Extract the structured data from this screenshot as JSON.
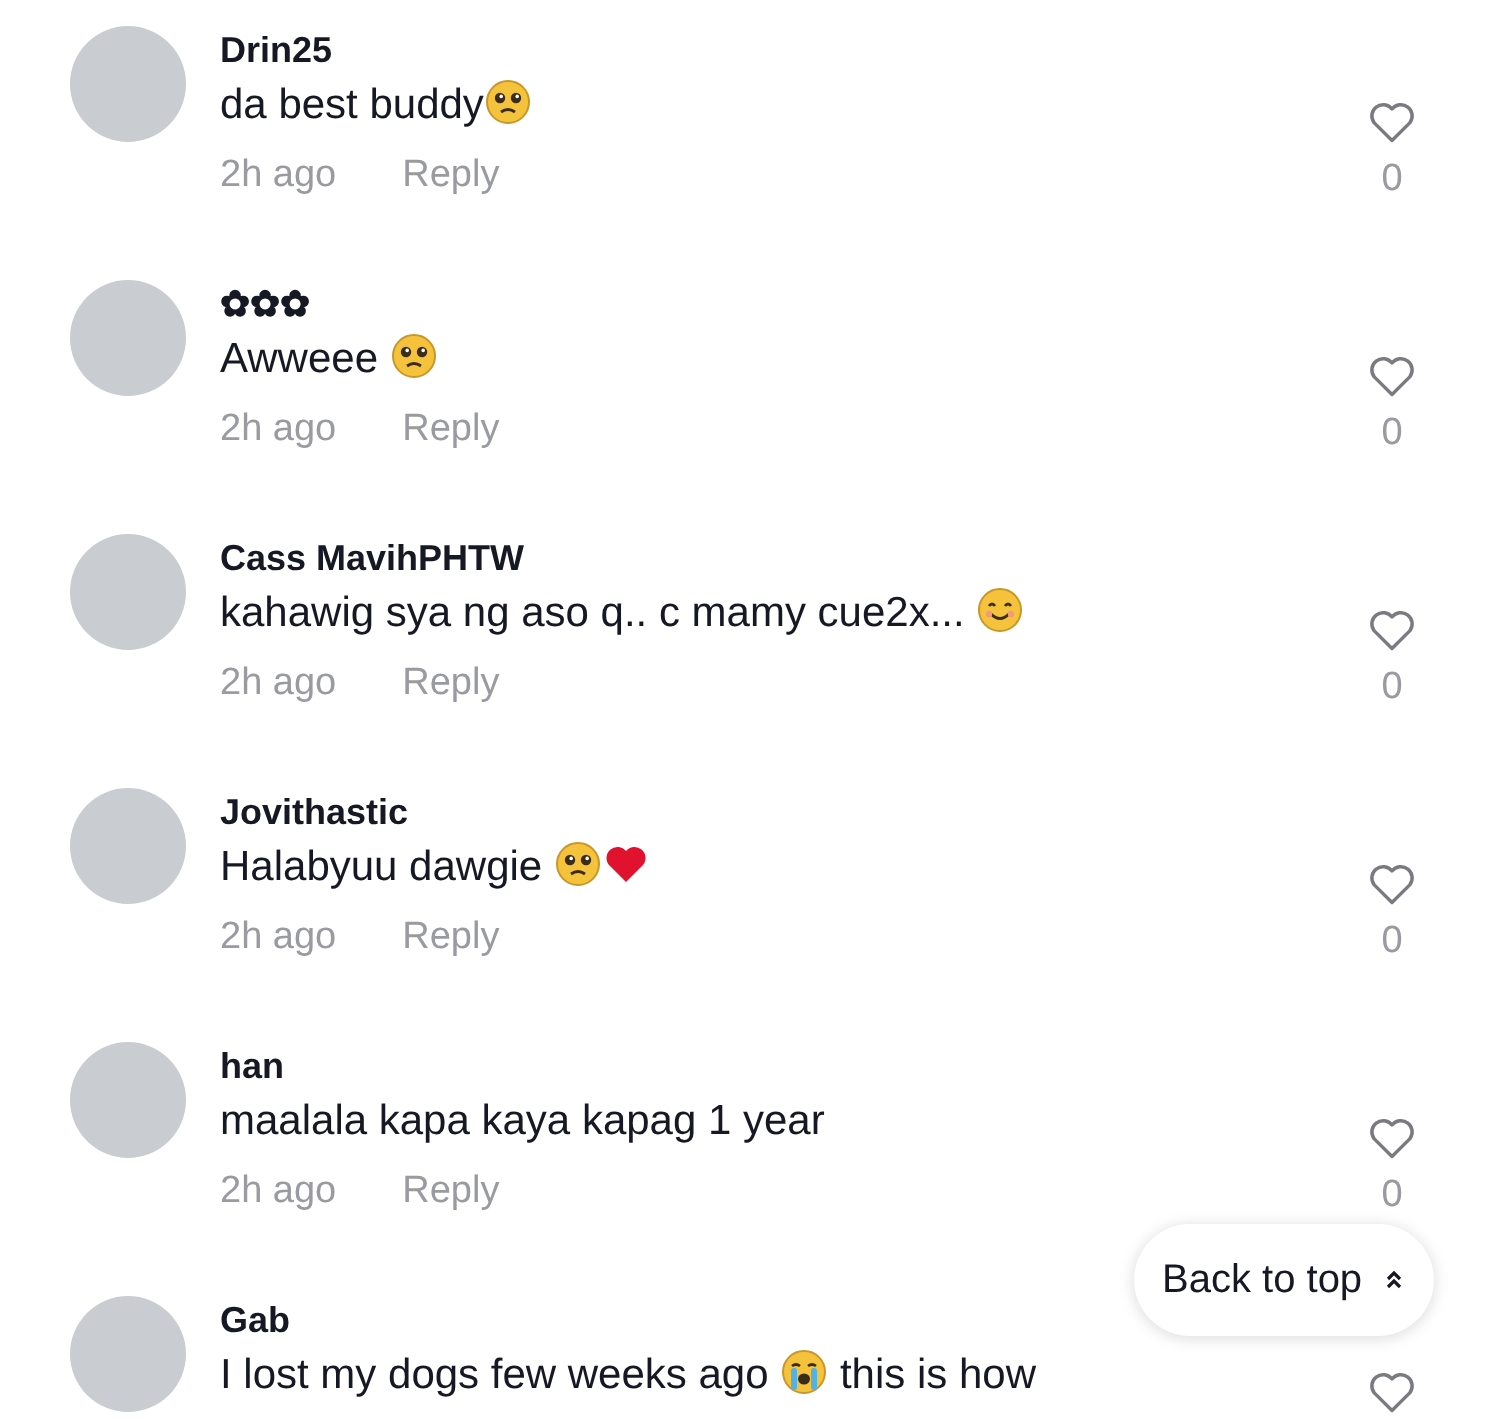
{
  "comments": [
    {
      "username": "Drin25",
      "parts": [
        {
          "kind": "text",
          "text": "da best buddy"
        },
        {
          "kind": "pleading"
        }
      ],
      "time": "2h ago",
      "reply": "Reply",
      "likes": "0",
      "liked": false
    },
    {
      "username": "✿✿✿",
      "parts": [
        {
          "kind": "text",
          "text": "Awweee "
        },
        {
          "kind": "pleading"
        }
      ],
      "time": "2h ago",
      "reply": "Reply",
      "likes": "0",
      "liked": false
    },
    {
      "username": "Cass MavihPHTW",
      "parts": [
        {
          "kind": "text",
          "text": "kahawig sya ng aso q.. c mamy cue2x... "
        },
        {
          "kind": "smiling"
        }
      ],
      "time": "2h ago",
      "reply": "Reply",
      "likes": "0",
      "liked": false
    },
    {
      "username": "Jovithastic",
      "parts": [
        {
          "kind": "text",
          "text": "Halabyuu dawgie "
        },
        {
          "kind": "pleading"
        },
        {
          "kind": "heart"
        }
      ],
      "time": "2h ago",
      "reply": "Reply",
      "likes": "0",
      "liked": false
    },
    {
      "username": "han",
      "parts": [
        {
          "kind": "text",
          "text": "maalala kapa kaya kapag 1 year"
        }
      ],
      "time": "2h ago",
      "reply": "Reply",
      "likes": "0",
      "liked": false
    },
    {
      "username": "Gab",
      "parts": [
        {
          "kind": "text",
          "text": "I lost my dogs few weeks ago "
        },
        {
          "kind": "crying"
        },
        {
          "kind": "text",
          "text": " this is how"
        }
      ],
      "liked": false
    }
  ],
  "back_to_top": {
    "label": "Back to top"
  }
}
